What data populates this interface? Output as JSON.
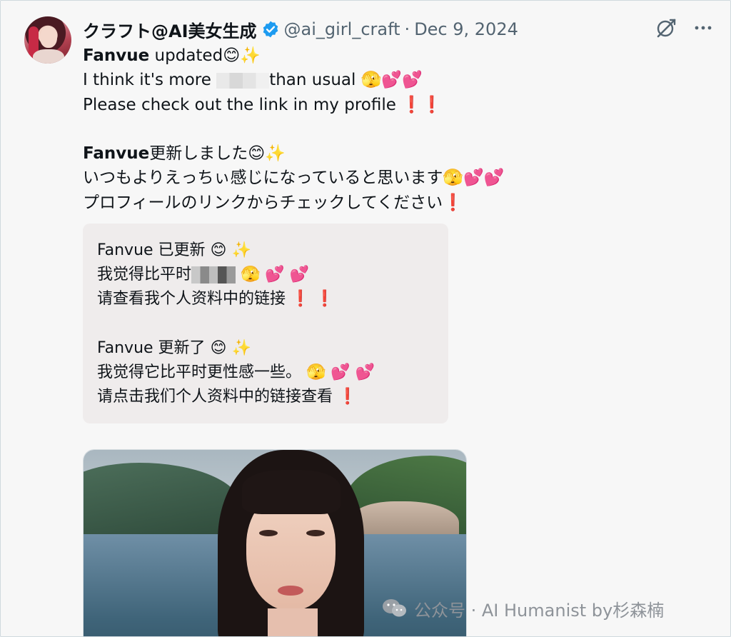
{
  "tweet": {
    "author_name": "クラフト@AI美女生成",
    "handle": "@ai_girl_craft",
    "separator": "·",
    "date": "Dec 9, 2024",
    "lines": [
      {
        "bold": "Fanvue",
        "text": " updated",
        "emoji": "😊✨"
      },
      {
        "pre": "I think it's more ",
        "post": "than usual ",
        "emoji": "🫣💕💕"
      },
      {
        "text": "Please check out the link in my profile ",
        "emoji": "❗❗"
      },
      {
        "bold": "Fanvue",
        "text": "更新しました",
        "emoji": "😊✨"
      },
      {
        "text": "いつもよりえっちぃ感じになっていると思います",
        "emoji": "🫣💕💕"
      },
      {
        "text": "プロフィールのリンクからチェックしてください",
        "emoji": "❗"
      }
    ]
  },
  "translation": {
    "lines": [
      {
        "text": "Fanvue 已更新 ",
        "emoji": "😊 ✨"
      },
      {
        "pre": "我觉得比平时",
        "post": "",
        "emoji": "🫣 💕 💕"
      },
      {
        "text": "请查看我个人资料中的链接 ",
        "emoji": "❗ ❗"
      },
      {
        "text": "Fanvue 更新了 ",
        "emoji": "😊 ✨"
      },
      {
        "text": "我觉得它比平时更性感一些。 ",
        "emoji": "🫣 💕 💕"
      },
      {
        "text": "请点击我们个人资料中的链接查看 ",
        "emoji": "❗"
      }
    ]
  },
  "watermark": {
    "text": "公众号 · AI Humanist by杉森楠"
  },
  "icons": {
    "verified": "verified-badge-icon",
    "grok": "grok-icon",
    "more": "more-icon",
    "wechat": "wechat-icon"
  },
  "colors": {
    "verified": "#1d9bf0",
    "secondary_text": "#536471",
    "translation_bg": "#efecec"
  }
}
